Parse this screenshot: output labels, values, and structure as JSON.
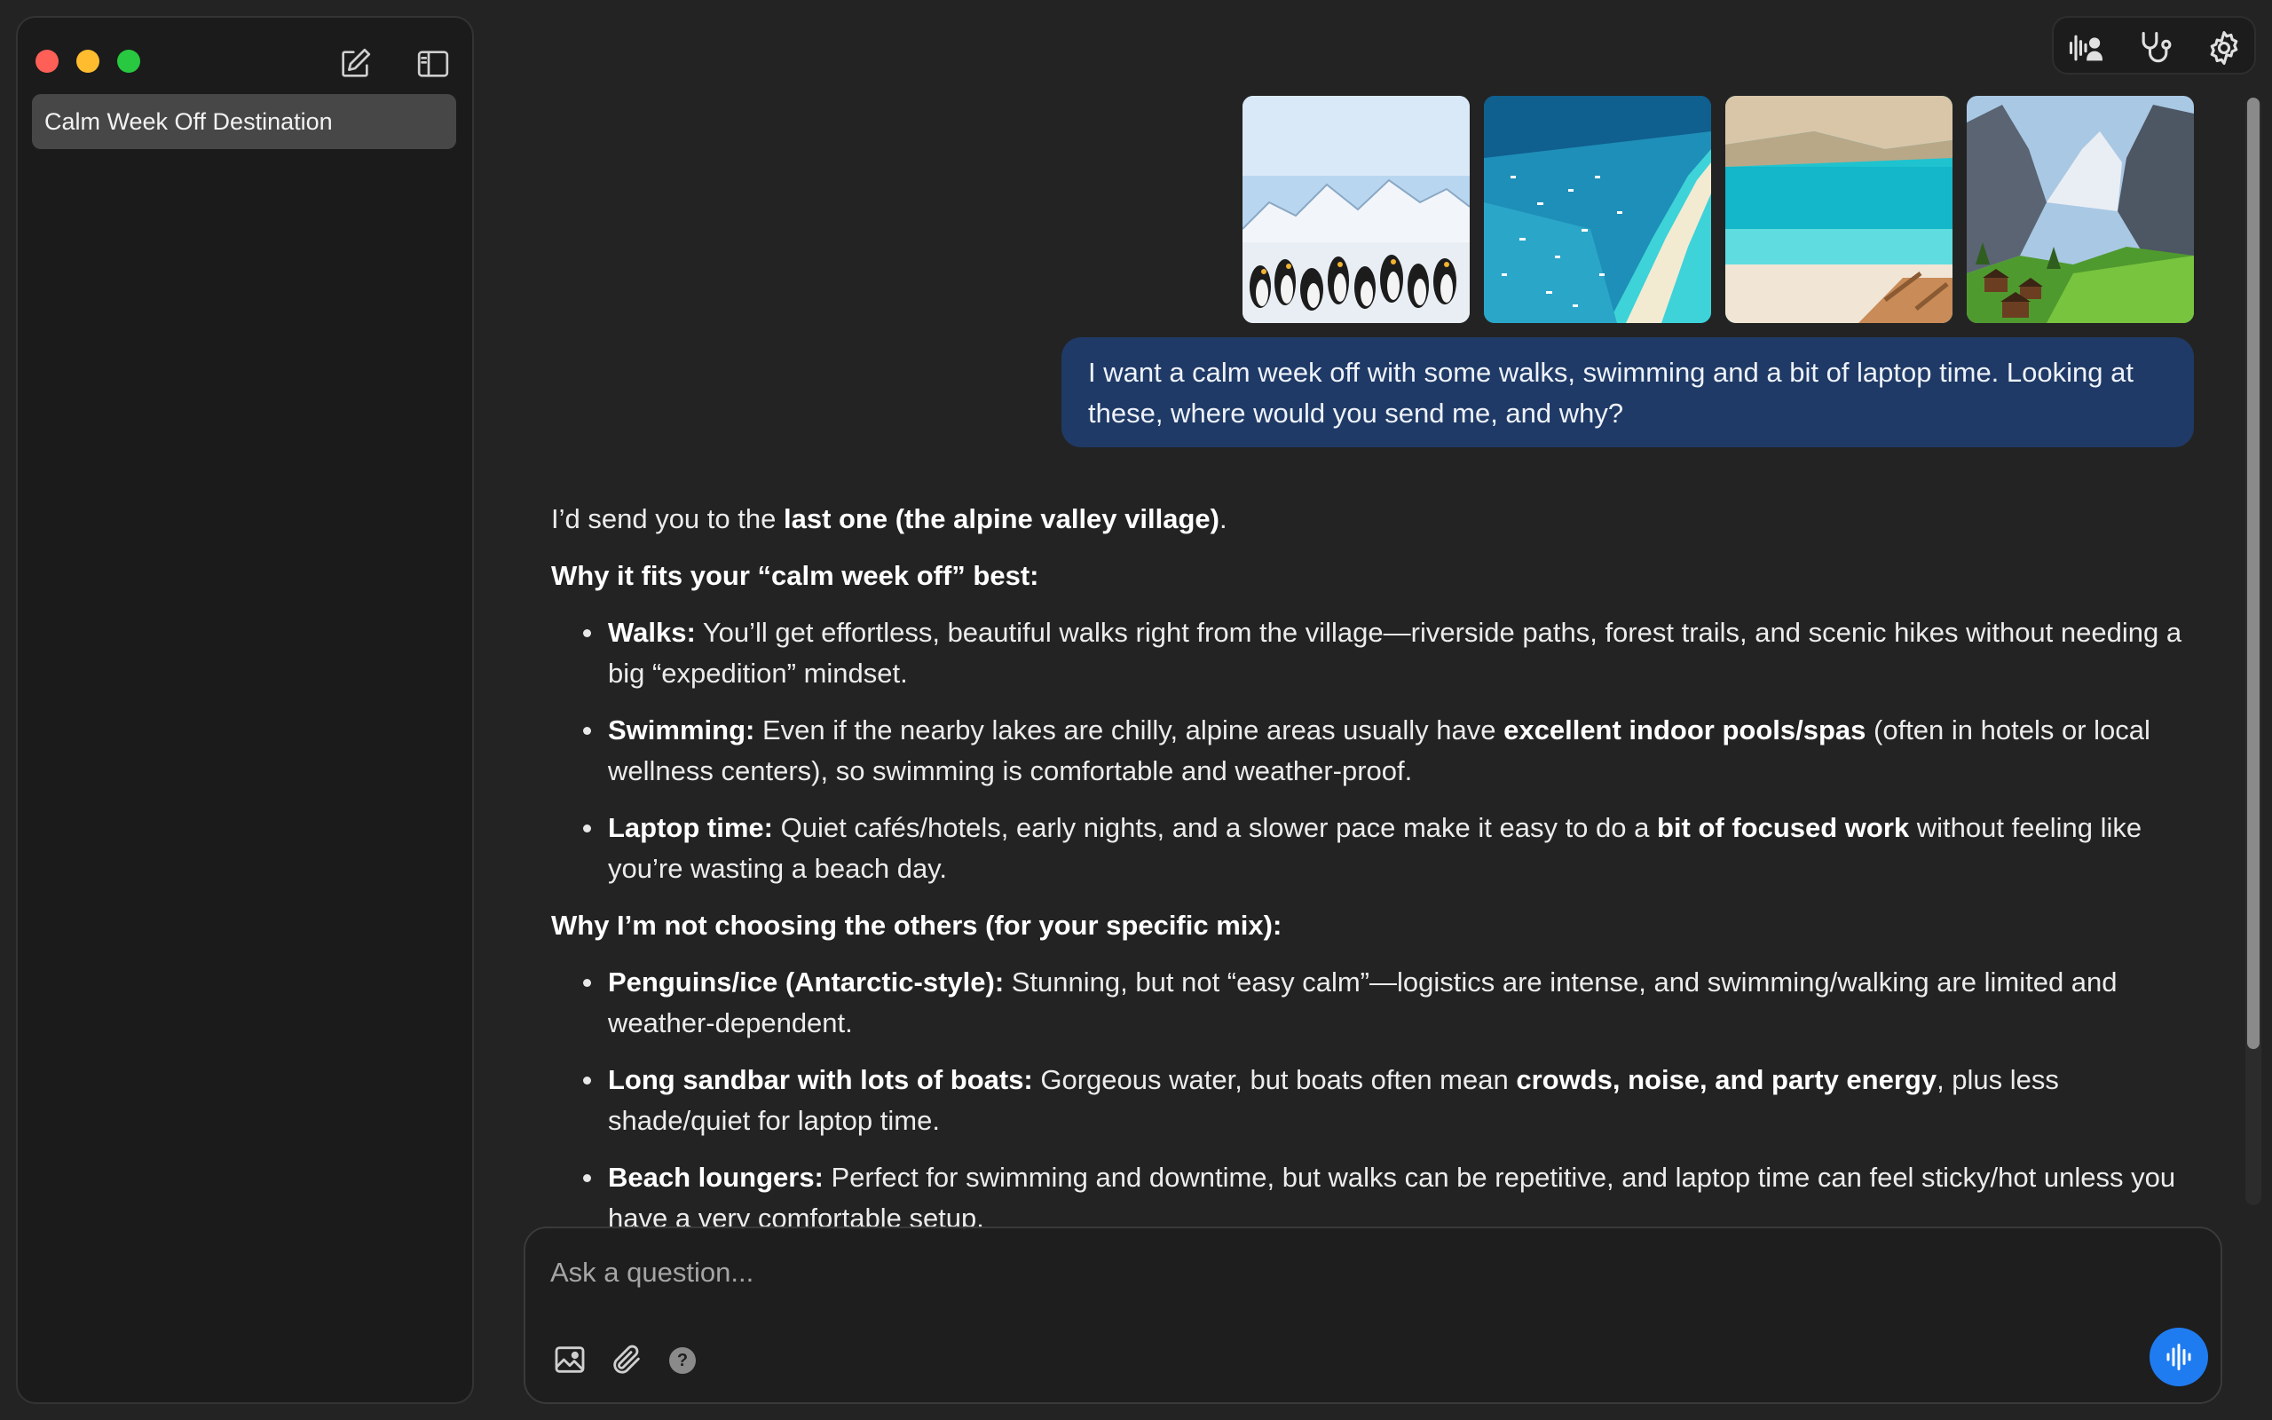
{
  "sidebar": {
    "conversations": [
      {
        "title": "Calm Week Off Destination"
      }
    ]
  },
  "toolbar": {
    "icons": [
      "voice-person-icon",
      "stethoscope-icon",
      "gear-icon"
    ]
  },
  "attachments": {
    "images": [
      "penguins-ice-thumbnail",
      "sandbar-boats-thumbnail",
      "beach-loungers-thumbnail",
      "alpine-village-thumbnail"
    ]
  },
  "conversation": {
    "user_message": "I want a calm week off with some walks, swimming and a bit of laptop time. Looking at these, where would you send me, and why?",
    "answer": {
      "intro_prefix": "I’d send you to the ",
      "intro_bold": "last one (the alpine valley village)",
      "intro_suffix": ".",
      "heading1": "Why it fits your “calm week off” best:",
      "fits": [
        {
          "label": "Walks:",
          "text": " You’ll get effortless, beautiful walks right from the village—riverside paths, forest trails, and scenic hikes without needing a big “expedition” mindset."
        },
        {
          "label": "Swimming:",
          "text_a": " Even if the nearby lakes are chilly, alpine areas usually have ",
          "bold": "excellent indoor pools/spas",
          "text_b": " (often in hotels or local wellness centers), so swimming is comfortable and weather-proof."
        },
        {
          "label": "Laptop time:",
          "text_a": " Quiet cafés/hotels, early nights, and a slower pace make it easy to do a ",
          "bold": "bit of focused work",
          "text_b": " without feeling like you’re wasting a beach day."
        }
      ],
      "heading2": "Why I’m not choosing the others (for your specific mix):",
      "others": [
        {
          "label": "Penguins/ice (Antarctic-style):",
          "text": " Stunning, but not “easy calm”—logistics are intense, and swimming/walking are limited and weather-dependent."
        },
        {
          "label": "Long sandbar with lots of boats:",
          "text_a": " Gorgeous water, but boats often mean ",
          "bold": "crowds, noise, and party energy",
          "text_b": ", plus less shade/quiet for laptop time."
        },
        {
          "label": "Beach loungers:",
          "text": " Perfect for swimming and downtime, but walks can be repetitive, and laptop time can feel sticky/hot unless you have a very comfortable setup."
        }
      ]
    }
  },
  "composer": {
    "placeholder": "Ask a question..."
  }
}
